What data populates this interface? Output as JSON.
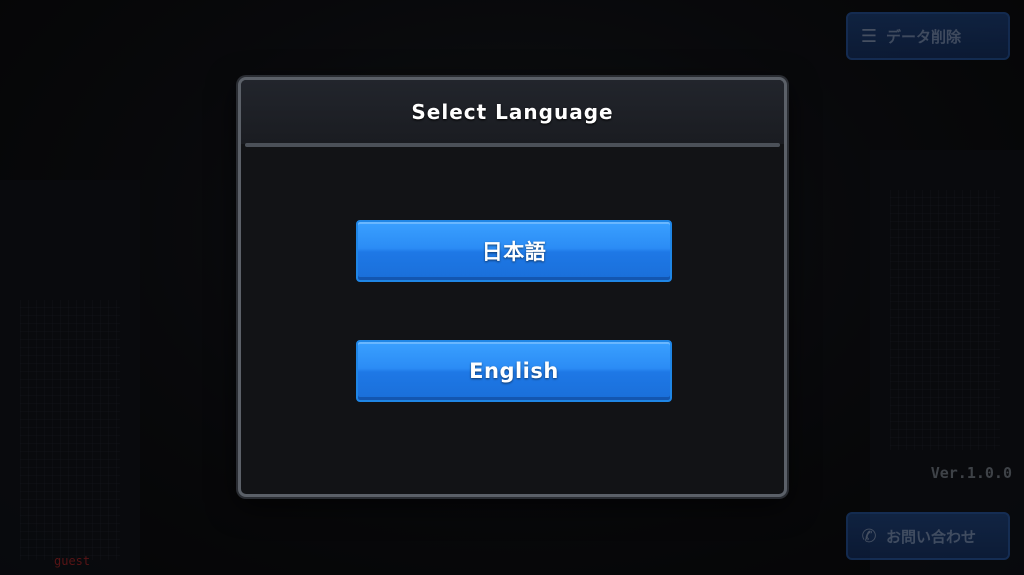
{
  "dialog": {
    "title": "Select Language",
    "options": [
      {
        "label": "日本語"
      },
      {
        "label": "English"
      }
    ]
  },
  "background": {
    "top_right_button": {
      "label": "データ削除",
      "icon": "database-icon"
    },
    "bottom_right_button": {
      "label": "お問い合わせ",
      "icon": "phone-icon"
    },
    "version_text": "Ver.1.0.0",
    "bottom_left_text": "guest"
  },
  "colors": {
    "button_blue": "#2b8cf5",
    "dialog_border": "#5b6068",
    "dialog_bg": "#121316"
  }
}
